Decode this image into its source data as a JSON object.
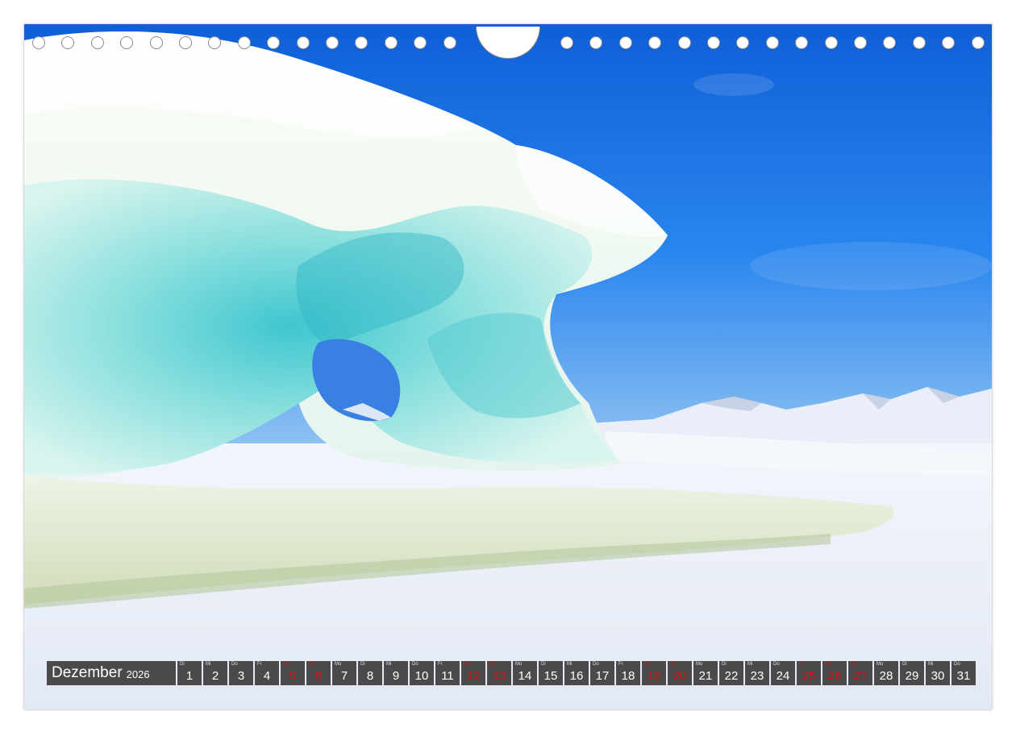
{
  "calendar": {
    "month": "Dezember",
    "year": "2026",
    "days": [
      {
        "wd": "Di",
        "n": "1",
        "red": false
      },
      {
        "wd": "Mi",
        "n": "2",
        "red": false
      },
      {
        "wd": "Do",
        "n": "3",
        "red": false
      },
      {
        "wd": "Fr",
        "n": "4",
        "red": false
      },
      {
        "wd": "Sa",
        "n": "5",
        "red": true
      },
      {
        "wd": "So",
        "n": "6",
        "red": true
      },
      {
        "wd": "Mo",
        "n": "7",
        "red": false
      },
      {
        "wd": "Di",
        "n": "8",
        "red": false
      },
      {
        "wd": "Mi",
        "n": "9",
        "red": false
      },
      {
        "wd": "Do",
        "n": "10",
        "red": false
      },
      {
        "wd": "Fr",
        "n": "11",
        "red": false
      },
      {
        "wd": "Sa",
        "n": "12",
        "red": true
      },
      {
        "wd": "So",
        "n": "13",
        "red": true
      },
      {
        "wd": "Mo",
        "n": "14",
        "red": false
      },
      {
        "wd": "Di",
        "n": "15",
        "red": false
      },
      {
        "wd": "Mi",
        "n": "16",
        "red": false
      },
      {
        "wd": "Do",
        "n": "17",
        "red": false
      },
      {
        "wd": "Fr",
        "n": "18",
        "red": false
      },
      {
        "wd": "Sa",
        "n": "19",
        "red": true
      },
      {
        "wd": "So",
        "n": "20",
        "red": true
      },
      {
        "wd": "Mo",
        "n": "21",
        "red": false
      },
      {
        "wd": "Di",
        "n": "22",
        "red": false
      },
      {
        "wd": "Mi",
        "n": "23",
        "red": false
      },
      {
        "wd": "Do",
        "n": "24",
        "red": false
      },
      {
        "wd": "Fr",
        "n": "25",
        "red": true
      },
      {
        "wd": "Sa",
        "n": "26",
        "red": true
      },
      {
        "wd": "So",
        "n": "27",
        "red": true
      },
      {
        "wd": "Mo",
        "n": "28",
        "red": false
      },
      {
        "wd": "Di",
        "n": "29",
        "red": false
      },
      {
        "wd": "Mi",
        "n": "30",
        "red": false
      },
      {
        "wd": "Do",
        "n": "31",
        "red": false
      }
    ]
  },
  "colors": {
    "sky": "#1f6fe0",
    "ice": "#6fd8dc",
    "snow": "#eef3fb",
    "strip": "#4a4a4a",
    "holiday": "#d01818"
  }
}
